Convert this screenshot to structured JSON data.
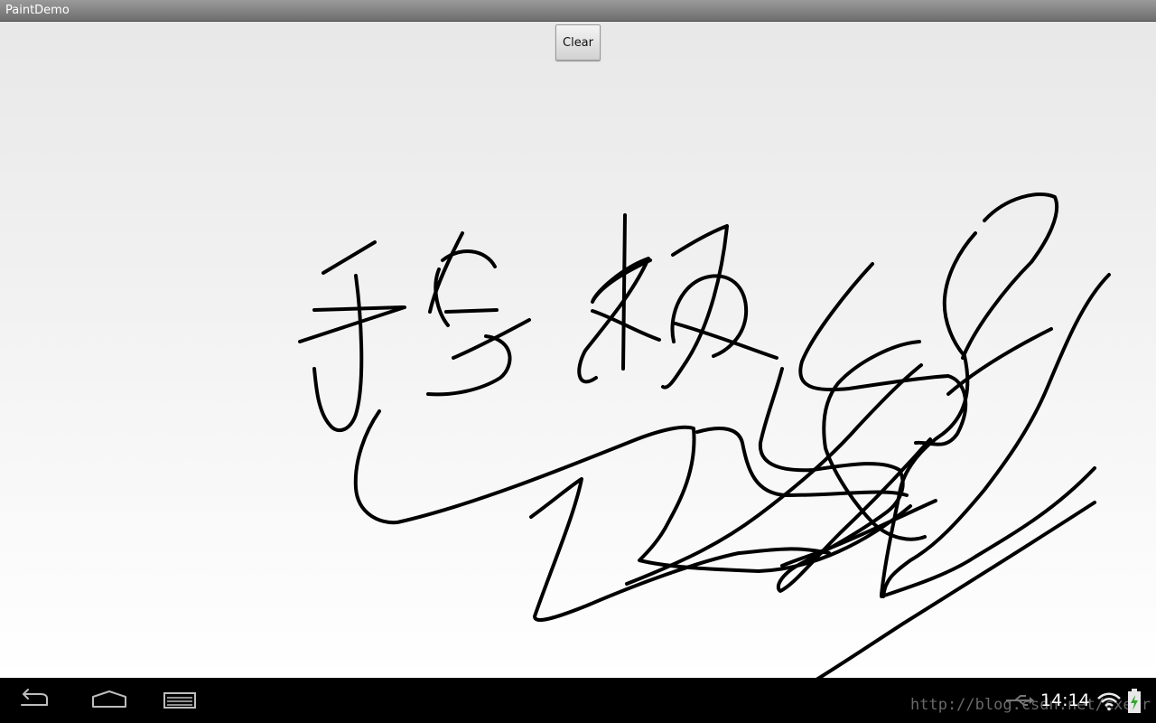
{
  "window": {
    "title": "PaintDemo"
  },
  "toolbar": {
    "clear_label": "Clear"
  },
  "canvas": {
    "stroke_color": "#000000",
    "background_top": "#e8e8e8",
    "background_bottom": "#ffffff"
  },
  "navbar": {
    "buttons": [
      {
        "icon": "back-icon"
      },
      {
        "icon": "home-icon"
      },
      {
        "icon": "recent-apps-icon"
      }
    ],
    "status": {
      "time": "14:14",
      "watermark": "http://blog.csdn.net/cxefr",
      "icons": [
        "usb-icon",
        "wifi-icon",
        "battery-charging-icon"
      ]
    }
  }
}
